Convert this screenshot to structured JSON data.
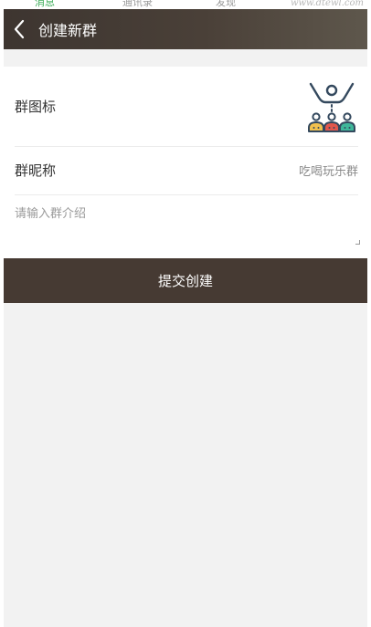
{
  "status_strip": {
    "items": [
      "消息",
      "通讯录",
      "发现"
    ],
    "watermark": "www.dtewl.com"
  },
  "header": {
    "back_icon": "chevron-left-icon",
    "title": "创建新群"
  },
  "form": {
    "group_icon": {
      "label": "群图标",
      "icon": "group-people-icon",
      "colors": [
        "#f2c14e",
        "#e2574c",
        "#3fb79a",
        "#34495e"
      ]
    },
    "group_nickname": {
      "label": "群昵称",
      "value": "吃喝玩乐群"
    },
    "group_intro": {
      "placeholder": "请输入群介绍",
      "value": ""
    }
  },
  "submit_label": "提交创建",
  "colors": {
    "header_bg": "#3d3530",
    "submit_bg": "#463a33",
    "page_bg": "#f2f2f2"
  }
}
